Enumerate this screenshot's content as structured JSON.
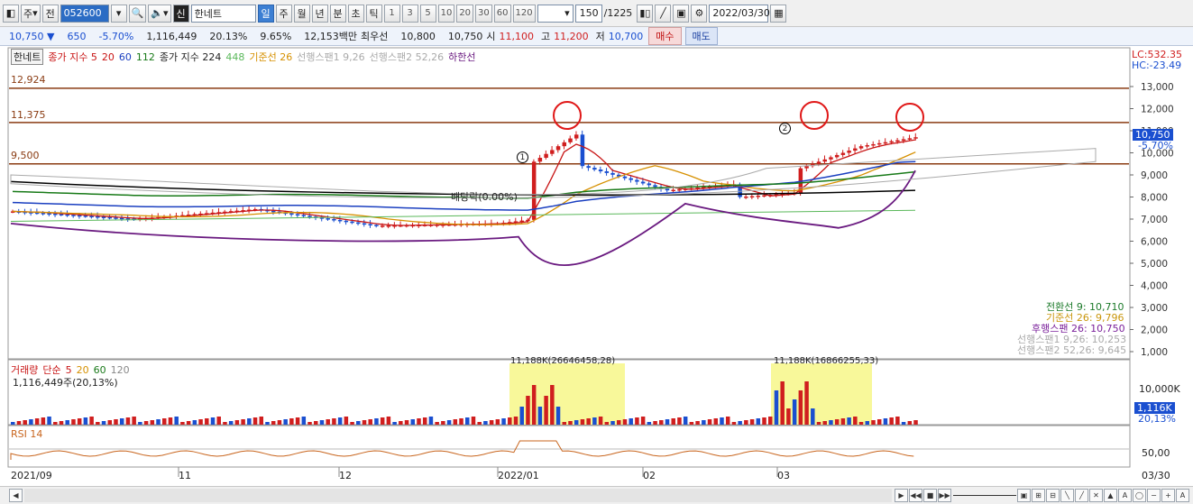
{
  "toolbar": {
    "period_main": "주",
    "prefix": "전",
    "stock_code": "052600",
    "stock_name_tag": "신",
    "stock_name": "한네트",
    "periods": [
      "일",
      "주",
      "월",
      "년",
      "분",
      "초",
      "틱"
    ],
    "active_period": "일",
    "intervals": [
      "1",
      "3",
      "5",
      "10",
      "20",
      "30",
      "60",
      "120"
    ],
    "count": "150",
    "count_total": "/1225",
    "date": "2022/03/30"
  },
  "quote": {
    "price": "10,750",
    "change": "650",
    "change_pct": "-5.70%",
    "volume": "1,116,449",
    "vol_ratio": "20.13%",
    "turnover_pct": "9.65%",
    "amount": "12,153백만",
    "best_label": "최우선",
    "best_ask": "10,800",
    "best_bid": "10,750",
    "open_label": "시",
    "open": "11,100",
    "high_label": "고",
    "high": "11,200",
    "low_label": "저",
    "low": "10,700",
    "buy_label": "매수",
    "sell_label": "매도"
  },
  "price_panel": {
    "legend": {
      "name": "한네트",
      "ma_label": "종가 지수",
      "ma_periods": [
        "5",
        "20",
        "60",
        "112"
      ],
      "ma2_label": "종가 지수",
      "ma2_periods": [
        "224",
        "448"
      ],
      "kijun": "기준선 26",
      "span1": "선행스팬1 9,26",
      "span2": "선행스팬2 52,26",
      "lowline": "하한선"
    },
    "lc": "LC:532.35",
    "hc": "HC:-23.49",
    "levels": [
      "12,924",
      "11,375",
      "9,500"
    ],
    "y_ticks": [
      "13,000",
      "12,000",
      "11,000",
      "10,000",
      "9,000",
      "8,000",
      "7,000",
      "6,000",
      "5,000",
      "4,000",
      "3,000",
      "2,000",
      "1,000"
    ],
    "price_tag": "10,750",
    "price_tag_pct": "-5.70%",
    "dividend_note": "배당락(0.00%)",
    "markers": [
      "1",
      "2"
    ],
    "ichimoku_values": [
      {
        "label": "전환선 9: 10,710",
        "color": "#1c7a2a"
      },
      {
        "label": "기준선 26: 9,796",
        "color": "#c9960c"
      },
      {
        "label": "후행스팬 26: 10,750",
        "color": "#7a1f9a"
      },
      {
        "label": "선행스팬1 9,26: 10,253",
        "color": "#aaaaaa"
      },
      {
        "label": "선행스팬2 52,26: 9,645",
        "color": "#aaaaaa"
      }
    ]
  },
  "volume_panel": {
    "legend_label": "거래량",
    "legend_ma": "단순",
    "legend_periods": [
      "5",
      "20",
      "60",
      "120"
    ],
    "value": "1,116,449주(20,13%)",
    "box1_label": "11,188K(26646458,28)",
    "box2_label": "11,188K(16866255,33)",
    "y_tick": "10,000K",
    "tag": "1,116K",
    "tag_pct": "20,13%"
  },
  "rsi_panel": {
    "label": "RSI 14",
    "y_tick": "50,00"
  },
  "x_axis": {
    "labels": [
      "2021/09",
      "11",
      "12",
      "2022/01",
      "02",
      "03"
    ],
    "right_label": "03/30"
  },
  "colors": {
    "up": "#d01e1e",
    "down": "#1a4fd0",
    "ma5": "#c81414",
    "ma20": "#d69000",
    "ma60": "#1a3fc0",
    "ma112": "#187a18",
    "ma224": "#000000",
    "lowline": "#6a1a80",
    "kijun": "#d69000",
    "level": "#8a3b12"
  }
}
